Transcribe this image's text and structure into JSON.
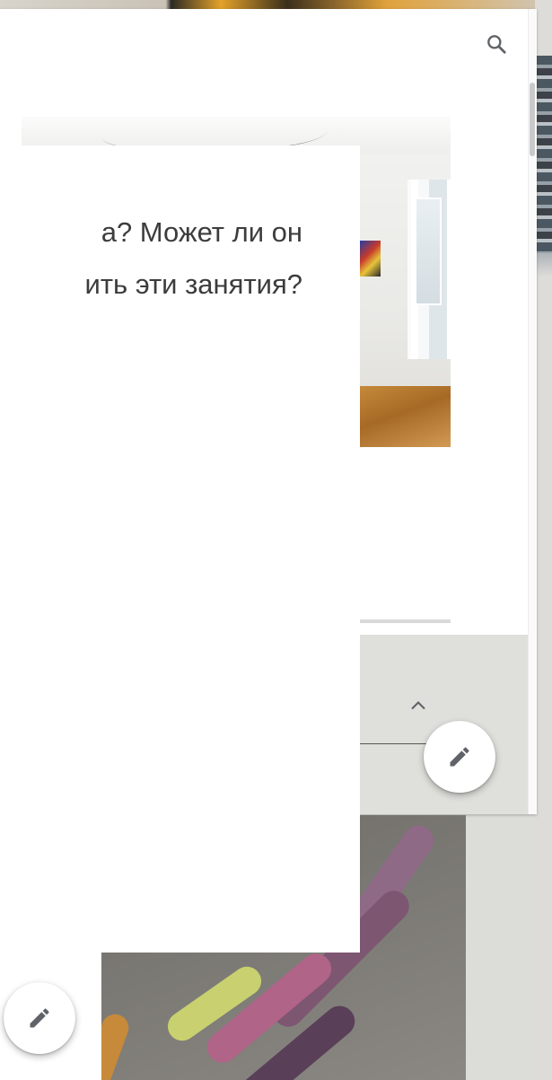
{
  "question": {
    "lines": [
      "а? Может ли он",
      "ить эти занятия?"
    ]
  },
  "icons": {
    "search": "search-icon",
    "chevron": "chevron-up-icon",
    "edit": "pencil-icon"
  },
  "colors": {
    "sheet": "#ffffff",
    "text": "#3c3c3c",
    "icon": "#5f6368",
    "panel": "#dfdfdb"
  }
}
